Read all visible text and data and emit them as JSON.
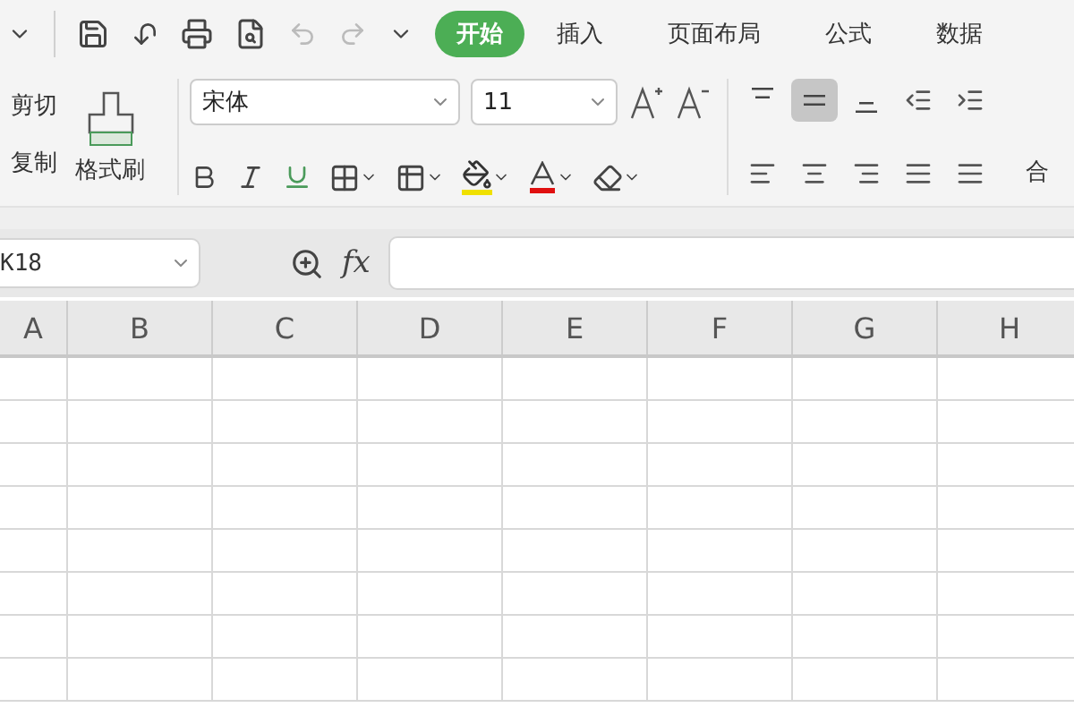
{
  "tabs": [
    {
      "label": "开始",
      "selected": true
    },
    {
      "label": "插入",
      "selected": false
    },
    {
      "label": "页面布局",
      "selected": false
    },
    {
      "label": "公式",
      "selected": false
    },
    {
      "label": "数据",
      "selected": false
    }
  ],
  "clipboard": {
    "cut": "剪切",
    "copy": "复制",
    "format_painter": "格式刷"
  },
  "font": {
    "name": "宋体",
    "size": "11"
  },
  "vertical_align": [
    {
      "selected": false
    },
    {
      "selected": true
    },
    {
      "selected": false
    }
  ],
  "merge_label": "合",
  "formula_bar": {
    "name_box": "K18",
    "fx": "fx"
  },
  "columns": [
    "A",
    "B",
    "C",
    "D",
    "E",
    "F",
    "G",
    "H"
  ]
}
